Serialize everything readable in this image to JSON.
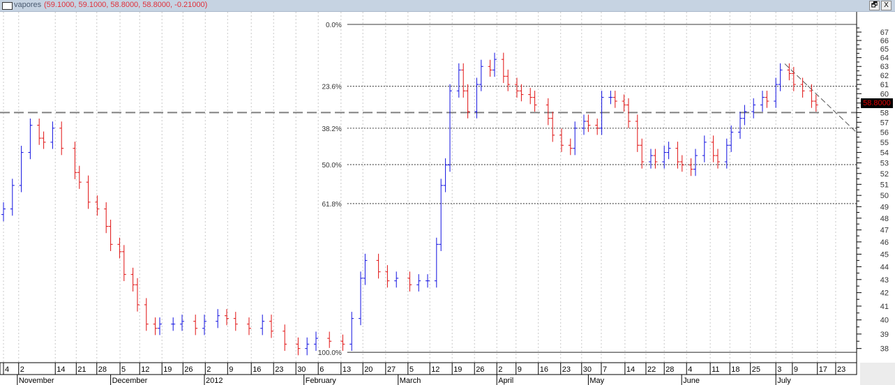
{
  "window": {
    "symbol": "vapores",
    "ohlc_text": "(59.1000, 59.1000, 58.8000, 58.8000, -0.21000)",
    "restore_label": "🗗",
    "close_label": "X"
  },
  "current_price": "58.8000",
  "chart_data": {
    "type": "ohlc",
    "title": "vapores",
    "scale": "log",
    "ylim": [
      37.7,
      67.9
    ],
    "xlim_days": [
      0,
      190
    ],
    "y_ticks": [
      38,
      39,
      40,
      41,
      42,
      43,
      44,
      45,
      46,
      47,
      48,
      49,
      50,
      51,
      52,
      53,
      54,
      55,
      56,
      57,
      58,
      59,
      60,
      61,
      62,
      63,
      64,
      65,
      66,
      67
    ],
    "x_ticks": [
      {
        "day": 0,
        "label": "4"
      },
      {
        "day": 3.4,
        "label": "2"
      },
      {
        "day": 11.6,
        "label": "14"
      },
      {
        "day": 16.3,
        "label": "21"
      },
      {
        "day": 20.9,
        "label": "28"
      },
      {
        "day": 26.1,
        "label": "5"
      },
      {
        "day": 30.5,
        "label": "12"
      },
      {
        "day": 35.5,
        "label": "19"
      },
      {
        "day": 40.2,
        "label": "26"
      },
      {
        "day": 45.2,
        "label": "2"
      },
      {
        "day": 50.2,
        "label": "9"
      },
      {
        "day": 55.5,
        "label": "16"
      },
      {
        "day": 60.5,
        "label": "23"
      },
      {
        "day": 65.5,
        "label": "30"
      },
      {
        "day": 70.5,
        "label": "6"
      },
      {
        "day": 75.6,
        "label": "13"
      },
      {
        "day": 80.5,
        "label": "20"
      },
      {
        "day": 85.6,
        "label": "27"
      },
      {
        "day": 90.6,
        "label": "5"
      },
      {
        "day": 95.5,
        "label": "12"
      },
      {
        "day": 100.5,
        "label": "19"
      },
      {
        "day": 105.5,
        "label": "26"
      },
      {
        "day": 110.5,
        "label": "2"
      },
      {
        "day": 114.8,
        "label": "9"
      },
      {
        "day": 119.8,
        "label": "16"
      },
      {
        "day": 124.8,
        "label": "23"
      },
      {
        "day": 129.5,
        "label": "30"
      },
      {
        "day": 133.9,
        "label": "7"
      },
      {
        "day": 139.2,
        "label": "14"
      },
      {
        "day": 143.9,
        "label": "22"
      },
      {
        "day": 148,
        "label": "28"
      },
      {
        "day": 153,
        "label": "4"
      },
      {
        "day": 158.3,
        "label": "11"
      },
      {
        "day": 162.7,
        "label": "18"
      },
      {
        "day": 167.3,
        "label": "25"
      },
      {
        "day": 173,
        "label": "3"
      },
      {
        "day": 176.7,
        "label": "9"
      },
      {
        "day": 182.3,
        "label": "17"
      },
      {
        "day": 186.4,
        "label": "23"
      }
    ],
    "months": [
      {
        "day": 3.1,
        "label": "November"
      },
      {
        "day": 24,
        "label": "December"
      },
      {
        "day": 45,
        "label": "2012"
      },
      {
        "day": 67.3,
        "label": "February"
      },
      {
        "day": 88.4,
        "label": "March"
      },
      {
        "day": 110.5,
        "label": "April"
      },
      {
        "day": 131,
        "label": "May"
      },
      {
        "day": 151.9,
        "label": "June"
      },
      {
        "day": 173,
        "label": "July"
      }
    ],
    "bars": [
      [
        0,
        48.8
      ],
      [
        2,
        50.9
      ],
      [
        4,
        54.0
      ],
      [
        6,
        56.7
      ],
      [
        8,
        55.4
      ],
      [
        9,
        55.0
      ],
      [
        11,
        56.4
      ],
      [
        13,
        54.4
      ],
      [
        16,
        52.1
      ],
      [
        17,
        51.2
      ],
      [
        19,
        49.4
      ],
      [
        21,
        48.8
      ],
      [
        23,
        47.3
      ],
      [
        24,
        45.8
      ],
      [
        26,
        45.2
      ],
      [
        27,
        43.4
      ],
      [
        29,
        42.6
      ],
      [
        30,
        41.1
      ],
      [
        32,
        39.7
      ],
      [
        34,
        39.4
      ],
      [
        35,
        39.7
      ],
      [
        38,
        39.7
      ],
      [
        40,
        39.9
      ],
      [
        43,
        39.4
      ],
      [
        45,
        39.9
      ],
      [
        48,
        40.3
      ],
      [
        50,
        40.1
      ],
      [
        52,
        39.7
      ],
      [
        55,
        39.4
      ],
      [
        58,
        39.9
      ],
      [
        60,
        39.2
      ],
      [
        63,
        38.3
      ],
      [
        66,
        38.0
      ],
      [
        68,
        38.3
      ],
      [
        70,
        38.7
      ],
      [
        73,
        38.5
      ],
      [
        76,
        38.3
      ],
      [
        78,
        40.1
      ],
      [
        80,
        43.1
      ],
      [
        81,
        44.5
      ],
      [
        84,
        43.6
      ],
      [
        86,
        42.9
      ],
      [
        88,
        43.1
      ],
      [
        91,
        42.6
      ],
      [
        93,
        42.9
      ],
      [
        95,
        42.9
      ],
      [
        97,
        45.8
      ],
      [
        98,
        50.9
      ],
      [
        99,
        52.8
      ],
      [
        100,
        60.3
      ],
      [
        102,
        62.6
      ],
      [
        103,
        60.3
      ],
      [
        104,
        58.1
      ],
      [
        106,
        61.0
      ],
      [
        107,
        63.0
      ],
      [
        109,
        62.6
      ],
      [
        110,
        63.8
      ],
      [
        112,
        61.9
      ],
      [
        113,
        61.0
      ],
      [
        115,
        60.3
      ],
      [
        116,
        59.9
      ],
      [
        118,
        59.6
      ],
      [
        119,
        58.8
      ],
      [
        122,
        57.4
      ],
      [
        123,
        55.7
      ],
      [
        125,
        54.7
      ],
      [
        127,
        54.4
      ],
      [
        128,
        56.4
      ],
      [
        130,
        57.1
      ],
      [
        131,
        56.7
      ],
      [
        133,
        56.4
      ],
      [
        134,
        59.6
      ],
      [
        136,
        59.6
      ],
      [
        137,
        59.2
      ],
      [
        139,
        58.8
      ],
      [
        140,
        57.1
      ],
      [
        142,
        54.7
      ],
      [
        143,
        53.1
      ],
      [
        145,
        53.7
      ],
      [
        146,
        53.1
      ],
      [
        148,
        54.0
      ],
      [
        149,
        54.4
      ],
      [
        151,
        53.1
      ],
      [
        152,
        52.8
      ],
      [
        154,
        52.4
      ],
      [
        155,
        53.7
      ],
      [
        157,
        55.0
      ],
      [
        159,
        53.7
      ],
      [
        160,
        53.1
      ],
      [
        162,
        54.7
      ],
      [
        163,
        56.0
      ],
      [
        165,
        57.4
      ],
      [
        166,
        58.1
      ],
      [
        168,
        58.8
      ],
      [
        170,
        59.6
      ],
      [
        171,
        59.2
      ],
      [
        173,
        61.0
      ],
      [
        174,
        62.6
      ],
      [
        176,
        62.2
      ],
      [
        177,
        61.0
      ],
      [
        179,
        60.3
      ],
      [
        181,
        59.2
      ],
      [
        182,
        58.8
      ]
    ],
    "fibonacci": {
      "high": 67.93,
      "low": 37.74,
      "levels": [
        {
          "ratio": 0,
          "label": "0.0%",
          "style": "solid"
        },
        {
          "ratio": 0.236,
          "label": "23.6%",
          "style": "dotted"
        },
        {
          "ratio": 0.382,
          "label": "38.2%",
          "style": "dotted"
        },
        {
          "ratio": 0.5,
          "label": "50.0%",
          "style": "dotted"
        },
        {
          "ratio": 0.618,
          "label": "61.8%",
          "style": "dotted"
        },
        {
          "ratio": 1,
          "label": "100.0%",
          "style": "solid"
        }
      ],
      "start_day": 77
    },
    "horizontal_line": 58.0,
    "trendline": {
      "from": {
        "day": 175,
        "price": 63.3
      },
      "to": {
        "day": 191,
        "price": 56.0
      }
    },
    "colors": {
      "up": "#1010e0",
      "down": "#e01010",
      "grid": "#c8c8c8",
      "axis": "#000000",
      "line": "#808080"
    }
  }
}
